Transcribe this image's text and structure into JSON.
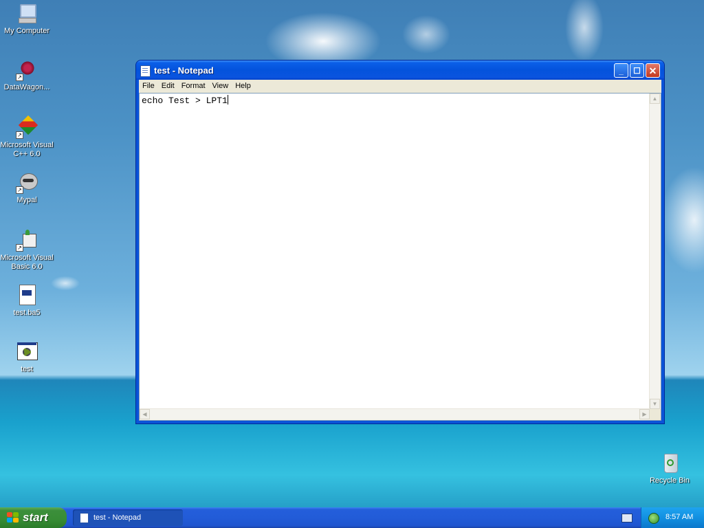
{
  "desktop": {
    "icons": [
      {
        "label": "My Computer",
        "icon": "my-computer-icon"
      },
      {
        "label": "DataWagon...",
        "icon": "datawagon-icon"
      },
      {
        "label": "Microsoft Visual C++ 6.0",
        "icon": "visual-cpp-icon"
      },
      {
        "label": "Mypal",
        "icon": "mypal-raccoon-icon"
      },
      {
        "label": "Microsoft Visual Basic 6.0",
        "icon": "visual-basic-icon"
      },
      {
        "label": "test.ba5",
        "icon": "document-file-icon"
      },
      {
        "label": "test",
        "icon": "executable-gear-icon"
      },
      {
        "label": "Recycle Bin",
        "icon": "recycle-bin-icon"
      }
    ]
  },
  "window": {
    "title": "test - Notepad",
    "menu": [
      "File",
      "Edit",
      "Format",
      "View",
      "Help"
    ],
    "content": "echo Test > LPT1"
  },
  "taskbar": {
    "start_label": "start",
    "task_button_label": "test - Notepad",
    "clock": "8:57 AM"
  },
  "colors": {
    "titlebar": "#0453dc",
    "taskbar": "#245edb",
    "start_button": "#378c35",
    "close_button": "#c3381e"
  }
}
